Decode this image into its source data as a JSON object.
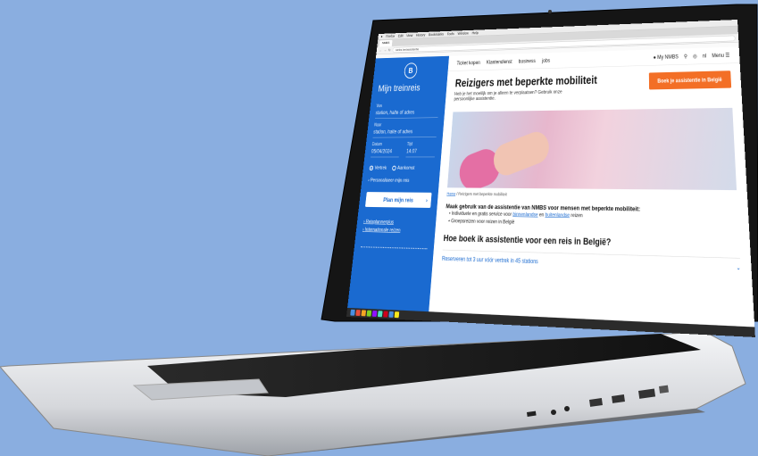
{
  "browser": {
    "menubar": [
      "Firefox",
      "Edit",
      "View",
      "History",
      "Bookmarks",
      "Tools",
      "Window",
      "Help"
    ],
    "tab_label": "NMBS",
    "url": "nmbs.be/assistentie"
  },
  "sidebar": {
    "logo_letter": "B",
    "title": "Mijn treinreis",
    "from_label": "Van",
    "from_placeholder": "station, halte of adres",
    "to_label": "Naar",
    "to_placeholder": "station, halte of adres",
    "date_label": "Datum",
    "date_value": "05/04/2024",
    "time_label": "Tijd",
    "time_value": "14:07",
    "radio_depart": "Vertrek",
    "radio_arrive": "Aankomst",
    "personalise": "Personaliseer mijn reis",
    "plan_button": "Plan mijn reis",
    "link_reisplanner": "Reisplannerplus",
    "link_international": "Internationale reizen"
  },
  "topnav": {
    "items": [
      "Ticket kopen",
      "Klantendienst",
      "business",
      "jobs"
    ],
    "my_nmbs": "My NMBS",
    "lang": "nl",
    "menu": "Menu"
  },
  "hero": {
    "title": "Reizigers met beperkte mobiliteit",
    "subtitle": "Heb je het moeilijk om je alleen te verplaatsen? Gebruik onze persoonlijke assistentie.",
    "book_button": "Boek je assistentie in België"
  },
  "breadcrumb": {
    "home": "Home",
    "current": "Reizigers met beperkte mobiliteit"
  },
  "content": {
    "lead": "Maak gebruik van de assistentie van NMBS voor mensen met beperkte mobiliteit:",
    "bullet1_pre": "Individuele en gratis service voor",
    "bullet1_link1": "binnenlandse",
    "bullet1_mid": "en",
    "bullet1_link2": "buitenlandse",
    "bullet1_post": "reizen",
    "bullet2": "Groepsreizen voor reizen in België",
    "h2": "Hoe boek ik assistentie voor een reis in België?",
    "accordion": "Reserveren tot 3 uur vóór vertrek in 45 stations"
  },
  "colors": {
    "brand_blue": "#1a6ad0",
    "accent_orange": "#f36f26",
    "background": "#8aaee0"
  }
}
